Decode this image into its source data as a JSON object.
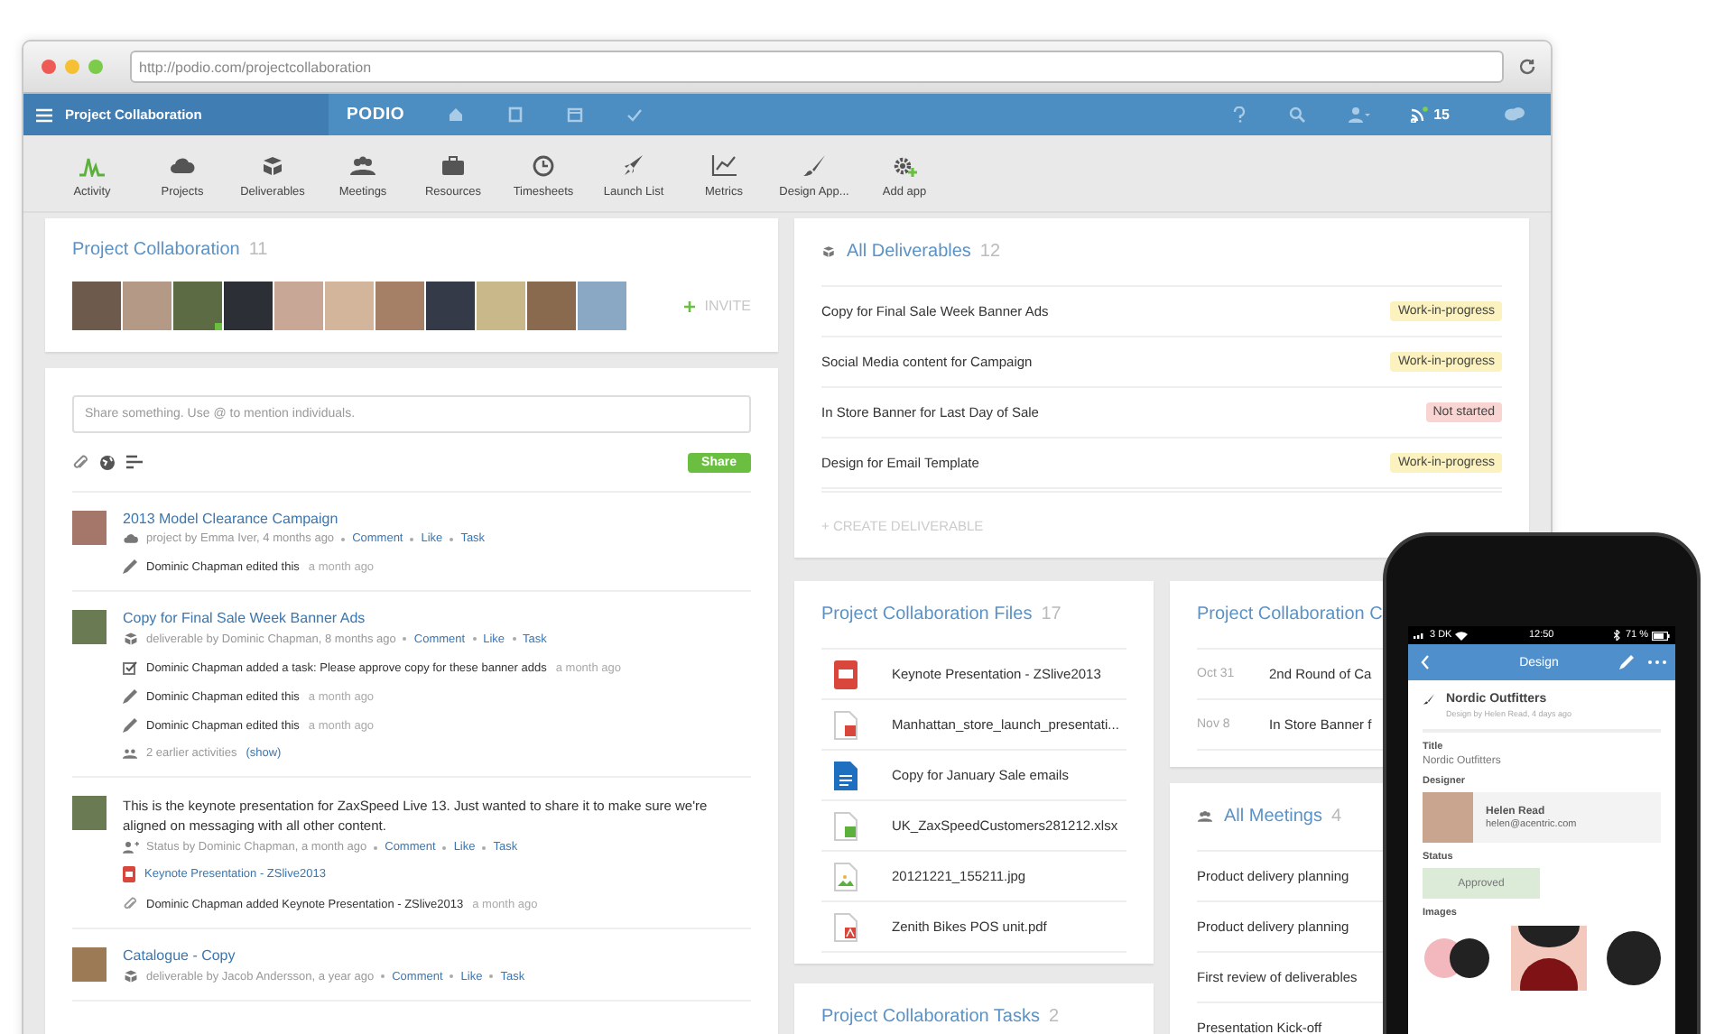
{
  "browser": {
    "url": "http://podio.com/projectcollaboration"
  },
  "nav": {
    "workspace": "Project Collaboration",
    "logo": "PODIO",
    "notifications": "15"
  },
  "apps": [
    {
      "label": "Activity",
      "kind": "activity",
      "selected": true
    },
    {
      "label": "Projects",
      "kind": "cloud",
      "selected": false
    },
    {
      "label": "Deliverables",
      "kind": "package",
      "selected": false
    },
    {
      "label": "Meetings",
      "kind": "people",
      "selected": false
    },
    {
      "label": "Resources",
      "kind": "briefcase",
      "selected": false
    },
    {
      "label": "Timesheets",
      "kind": "clock",
      "selected": false
    },
    {
      "label": "Launch List",
      "kind": "rocket",
      "selected": false
    },
    {
      "label": "Metrics",
      "kind": "chart",
      "selected": false
    },
    {
      "label": "Design App...",
      "kind": "brush",
      "selected": false
    },
    {
      "label": "Add app",
      "kind": "gear",
      "selected": false
    }
  ],
  "members_card": {
    "title": "Project Collaboration",
    "count": "11",
    "invite": "INVITE",
    "members": [
      {
        "online": false
      },
      {
        "online": false
      },
      {
        "online": true
      },
      {
        "online": false
      },
      {
        "online": false
      },
      {
        "online": false
      },
      {
        "online": false
      },
      {
        "online": false
      },
      {
        "online": false
      },
      {
        "online": false
      },
      {
        "online": false
      }
    ]
  },
  "composer": {
    "placeholder": "Share something. Use @ to mention individuals.",
    "share": "Share"
  },
  "feed": [
    {
      "kind": "project",
      "title": "2013 Model Clearance Campaign",
      "meta": "project by Emma Iver, 4 months ago",
      "actions": [
        "Comment",
        "Like",
        "Task"
      ],
      "activities": [
        {
          "kind": "edit",
          "text": "Dominic Chapman edited this",
          "time": "a month ago"
        }
      ]
    },
    {
      "kind": "deliverable",
      "title": "Copy for Final Sale Week Banner Ads",
      "meta": "deliverable by Dominic Chapman, 8 months ago",
      "actions": [
        "Comment",
        "Like",
        "Task"
      ],
      "activities": [
        {
          "kind": "task",
          "text": "Dominic Chapman added a task: Please approve copy for these banner adds",
          "time": "a month ago"
        },
        {
          "kind": "edit",
          "text": "Dominic Chapman edited this",
          "time": "a month ago"
        },
        {
          "kind": "edit",
          "text": "Dominic Chapman edited this",
          "time": "a month ago"
        },
        {
          "kind": "earlier",
          "text": "2 earlier activities",
          "link": "(show)"
        }
      ]
    },
    {
      "kind": "status",
      "body": "This is the keynote presentation for ZaxSpeed Live 13. Just wanted to share it to make sure we're aligned on messaging with all other content.",
      "meta": "Status by Dominic Chapman, a month ago",
      "actions": [
        "Comment",
        "Like",
        "Task"
      ],
      "attachment": "Keynote Presentation - ZSlive2013",
      "activities": [
        {
          "kind": "attach",
          "text": "Dominic Chapman added Keynote Presentation - ZSlive2013",
          "time": "a month ago"
        }
      ]
    },
    {
      "kind": "deliverable",
      "title": "Catalogue - Copy",
      "meta": "deliverable by Jacob Andersson, a year ago",
      "actions": [
        "Comment",
        "Like",
        "Task"
      ]
    }
  ],
  "deliverables": {
    "title": "All Deliverables",
    "count": "12",
    "create": "+ CREATE DELIVERABLE",
    "items": [
      {
        "name": "Copy for Final Sale Week Banner Ads",
        "status": "Work-in-progress",
        "color": "#fbf2c0"
      },
      {
        "name": "Social Media content for Campaign",
        "status": "Work-in-progress",
        "color": "#fbf2c0"
      },
      {
        "name": "In Store Banner for Last Day of Sale",
        "status": "Not started",
        "color": "#f8d4d2"
      },
      {
        "name": "Design for Email Template",
        "status": "Work-in-progress",
        "color": "#fbf2c0"
      }
    ]
  },
  "files": {
    "title": "Project Collaboration Files",
    "count": "17",
    "items": [
      {
        "name": "Keynote Presentation - ZSlive2013",
        "kind": "keynote"
      },
      {
        "name": "Manhattan_store_launch_presentati...",
        "kind": "ppt"
      },
      {
        "name": "Copy for January Sale emails",
        "kind": "doc"
      },
      {
        "name": "UK_ZaxSpeedCustomers281212.xlsx",
        "kind": "xls"
      },
      {
        "name": "20121221_155211.jpg",
        "kind": "image"
      },
      {
        "name": "Zenith Bikes POS unit.pdf",
        "kind": "pdf"
      }
    ]
  },
  "tasks": {
    "title": "Project Collaboration Tasks",
    "count": "2"
  },
  "calendar": {
    "title": "Project Collaboration C",
    "events": [
      {
        "date": "Oct 31",
        "name": "2nd Round of Ca"
      },
      {
        "date": "Nov 8",
        "name": "In Store Banner f"
      }
    ]
  },
  "meetings": {
    "title": "All Meetings",
    "count": "4",
    "items": [
      "Product delivery planning",
      "Product delivery planning",
      "First review of deliverables",
      "Presentation Kick-off"
    ]
  },
  "phone": {
    "carrier": "3 DK",
    "time": "12:50",
    "battery": "71 %",
    "header": "Design",
    "item_title": "Nordic Outfitters",
    "item_meta": "Design by Helen Read, 4 days ago",
    "fields": [
      {
        "kind": "text",
        "label": "Title",
        "value": "Nordic Outfitters"
      },
      {
        "kind": "contact",
        "label": "Designer",
        "name": "Helen Read",
        "email": "helen@acentric.com"
      },
      {
        "kind": "status",
        "label": "Status",
        "value": "Approved"
      },
      {
        "kind": "images",
        "label": "Images"
      }
    ]
  }
}
